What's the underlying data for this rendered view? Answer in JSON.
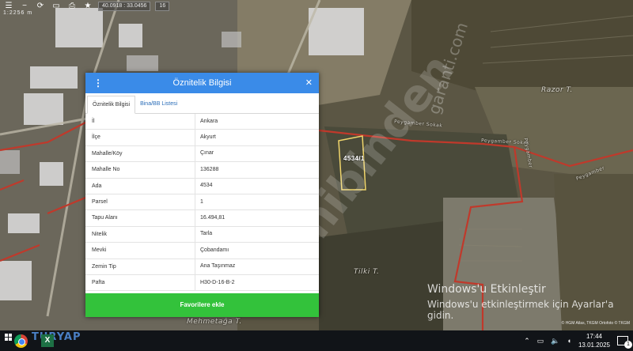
{
  "toolbar": {
    "coordinate": "40.0918 : 33.0456",
    "zoom": "16",
    "scale_text": "1:2256 m"
  },
  "map": {
    "parcel_label": "4534/1",
    "place_labels": {
      "razor": "Razor T.",
      "tilki": "Tilki T.",
      "mehmetaga": "Mehmetağa T."
    },
    "road_labels": [
      "Peygamber Sokak",
      "Peygamber Sokak",
      "Peygamber",
      "Peygamber"
    ],
    "attribution": "© HGM Atlas, TKGM Ortofoto © TKGM",
    "watermark": "sahibinden",
    "watermark_domain": "garanti.com",
    "colors": {
      "boundary": "#c0392b",
      "parcel": "#f1d66b"
    }
  },
  "dialog": {
    "title": "Öznitelik Bilgisi",
    "tabs": [
      "Öznitelik Bilgisi",
      "Bina/BB Listesi"
    ],
    "rows": [
      {
        "key": "İl",
        "value": "Ankara"
      },
      {
        "key": "İlçe",
        "value": "Akyurt"
      },
      {
        "key": "Mahalle/Köy",
        "value": "Çınar"
      },
      {
        "key": "Mahalle No",
        "value": "136288"
      },
      {
        "key": "Ada",
        "value": "4534"
      },
      {
        "key": "Parsel",
        "value": "1"
      },
      {
        "key": "Tapu Alanı",
        "value": "16.494,81"
      },
      {
        "key": "Nitelik",
        "value": "Tarla"
      },
      {
        "key": "Mevki",
        "value": "Çobandamı"
      },
      {
        "key": "Zemin Tip",
        "value": "Ana Taşınmaz"
      },
      {
        "key": "Pafta",
        "value": "H30-D-16-B-2"
      }
    ],
    "favorite_button": "Favorilere ekle",
    "header_color": "#3a8be8",
    "button_color": "#33c23b"
  },
  "windows": {
    "activate_title": "Windows'u Etkinleştir",
    "activate_hint": "Windows'u etkinleştirmek için Ayarlar'a gidin."
  },
  "taskbar": {
    "logo": "TURYAP",
    "time": "17:44",
    "date": "13.01.2025",
    "notification_count": "1"
  }
}
